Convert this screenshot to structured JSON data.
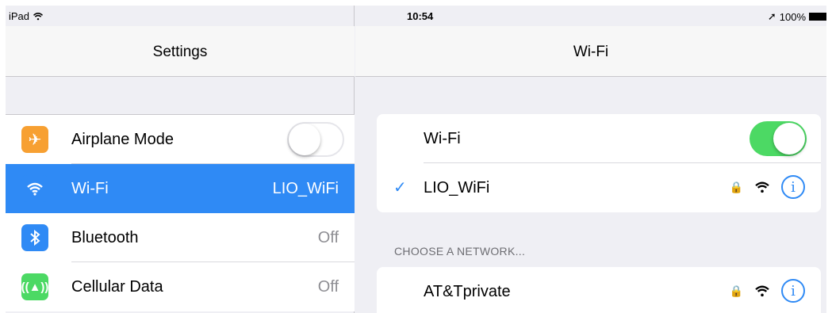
{
  "status_bar": {
    "device": "iPad",
    "time": "10:54",
    "battery": "100%",
    "icons": [
      "wifi-icon",
      "location-arrow-icon",
      "battery-icon"
    ]
  },
  "sidebar": {
    "title": "Settings",
    "items": [
      {
        "label": "Airplane Mode",
        "icon": "airplane-icon",
        "icon_color": "#f7a032",
        "control": "toggle-off"
      },
      {
        "label": "Wi-Fi",
        "value": "LIO_WiFi",
        "icon": "wifi-icon",
        "icon_color": "#2f8af5",
        "selected": true
      },
      {
        "label": "Bluetooth",
        "value": "Off",
        "icon": "bluetooth-icon",
        "icon_color": "#2f8af5"
      },
      {
        "label": "Cellular Data",
        "value": "Off",
        "icon": "antenna-icon",
        "icon_color": "#4cd964"
      }
    ]
  },
  "detail": {
    "title": "Wi-Fi",
    "wifi_label": "Wi-Fi",
    "wifi_on": true,
    "connected_network": "LIO_WiFi",
    "section_header": "CHOOSE A NETWORK...",
    "networks": [
      {
        "name": "AT&Tprivate",
        "locked": true
      }
    ]
  },
  "colors": {
    "accent": "#2f8af5",
    "toggle_on": "#4cd964",
    "background": "#efeff4"
  }
}
